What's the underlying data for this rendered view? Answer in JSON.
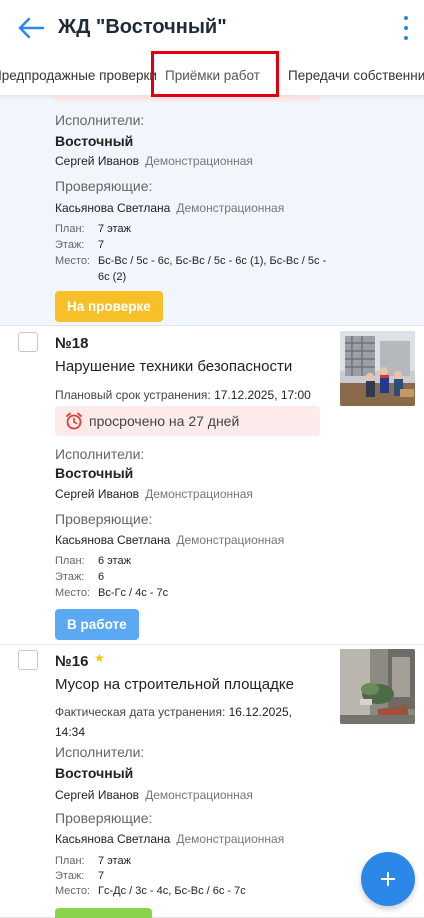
{
  "header": {
    "title": "ЖД \"Восточный\""
  },
  "tabs": [
    {
      "label": "Предпродажные проверки"
    },
    {
      "label": "Приёмки работ"
    },
    {
      "label": "Передачи собственникам"
    }
  ],
  "labels": {
    "performers": "Исполнители:",
    "reviewers": "Проверяющие:",
    "plan": "План:",
    "floor": "Этаж:",
    "place": "Место:",
    "planned_deadline": "Плановый срок устранения:",
    "actual_date": "Фактическая дата устранения:"
  },
  "cards": [
    {
      "organization": "Восточный",
      "performer_name": "Сергей Иванов",
      "performer_role": "Демонстрационная",
      "reviewer_name": "Касьянова Светлана",
      "reviewer_role": "Демонстрационная",
      "plan": "7 этаж",
      "floor": "7",
      "place": "Бс-Вс / 5с - 6с, Бс-Вс / 5с - 6с (1), Бс-Вс / 5с - 6с (2)",
      "status": "На проверке"
    },
    {
      "number": "№18",
      "title": "Нарушение техники безопасности",
      "date": "17.12.2025, 17:00",
      "overdue": "просрочено на 27 дней",
      "organization": "Восточный",
      "performer_name": "Сергей Иванов",
      "performer_role": "Демонстрационная",
      "reviewer_name": "Касьянова Светлана",
      "reviewer_role": "Демонстрационная",
      "plan": "6 этаж",
      "floor": "6",
      "place": "Вс-Гс / 4с - 7с",
      "status": "В работе"
    },
    {
      "number": "№16",
      "title": "Мусор на строительной площадке",
      "date": "16.12.2025, 14:34",
      "organization": "Восточный",
      "performer_name": "Сергей Иванов",
      "performer_role": "Демонстрационная",
      "reviewer_name": "Касьянова Светлана",
      "reviewer_role": "Демонстрационная",
      "plan": "7 этаж",
      "floor": "7",
      "place": "Гс-Дс / 3с - 4с, Бс-Вс / 6с - 7с"
    }
  ],
  "colors": {
    "accent": "#2b88e8",
    "status_review": "#f7c029",
    "status_work": "#5aa9f2",
    "status_done": "#8ad34a",
    "overdue_bg": "#fdebeb",
    "highlight": "#e0000d"
  },
  "icons": {
    "back": "arrow-left-icon",
    "menu": "more-vertical-icon",
    "clock": "alarm-clock-icon",
    "star": "star-icon",
    "add": "plus-icon"
  }
}
